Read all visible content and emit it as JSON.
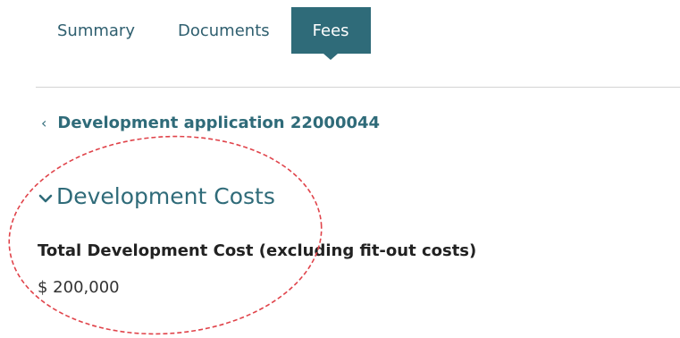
{
  "tabs": [
    {
      "label": "Summary",
      "active": false
    },
    {
      "label": "Documents",
      "active": false
    },
    {
      "label": "Fees",
      "active": true
    }
  ],
  "breadcrumb": {
    "label": "Development application 22000044",
    "icon": "chevron-left-icon"
  },
  "section": {
    "title": "Development Costs",
    "icon": "chevron-down-icon",
    "expanded": true
  },
  "field": {
    "label": "Total Development Cost (excluding fit-out costs)",
    "value": "$ 200,000"
  },
  "colors": {
    "accent": "#2f6b79",
    "annotation": "#e0434a"
  }
}
